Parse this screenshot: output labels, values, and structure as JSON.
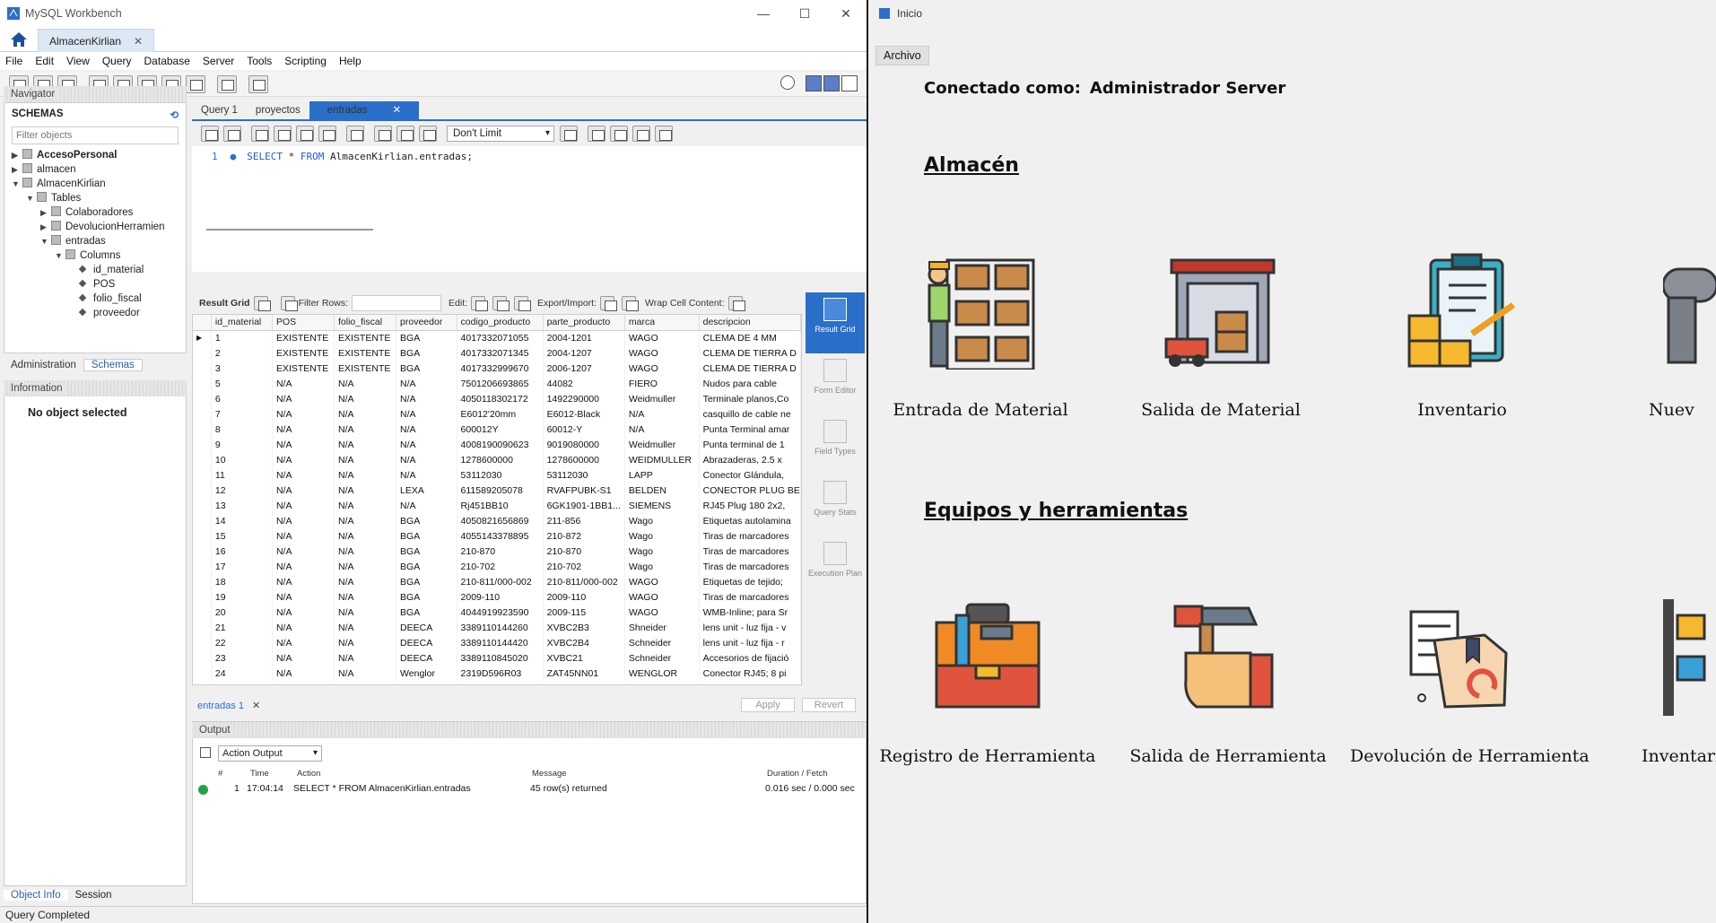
{
  "workbench": {
    "title": "MySQL Workbench",
    "connection_tab": "AlmacenKirlian",
    "menu": [
      "File",
      "Edit",
      "View",
      "Query",
      "Database",
      "Server",
      "Tools",
      "Scripting",
      "Help"
    ],
    "navigator_label": "Navigator",
    "schemas_label": "SCHEMAS",
    "filter_placeholder": "Filter objects",
    "tree": [
      {
        "label": "AccesoPersonal",
        "bold": true,
        "level": 0,
        "arrow": "▶",
        "icon": "db"
      },
      {
        "label": "almacen",
        "bold": false,
        "level": 0,
        "arrow": "▶",
        "icon": "db"
      },
      {
        "label": "AlmacenKirlian",
        "bold": false,
        "level": 0,
        "arrow": "▼",
        "icon": "db"
      },
      {
        "label": "Tables",
        "bold": false,
        "level": 1,
        "arrow": "▼",
        "icon": "folder"
      },
      {
        "label": "Colaboradores",
        "bold": false,
        "level": 2,
        "arrow": "▶",
        "icon": "table"
      },
      {
        "label": "DevolucionHerramien",
        "bold": false,
        "level": 2,
        "arrow": "▶",
        "icon": "table"
      },
      {
        "label": "entradas",
        "bold": false,
        "level": 2,
        "arrow": "▼",
        "icon": "table"
      },
      {
        "label": "Columns",
        "bold": false,
        "level": 3,
        "arrow": "▼",
        "icon": "folder"
      },
      {
        "label": "id_material",
        "bold": false,
        "level": 4,
        "arrow": "",
        "icon": "col"
      },
      {
        "label": "POS",
        "bold": false,
        "level": 4,
        "arrow": "",
        "icon": "col"
      },
      {
        "label": "folio_fiscal",
        "bold": false,
        "level": 4,
        "arrow": "",
        "icon": "col"
      },
      {
        "label": "proveedor",
        "bold": false,
        "level": 4,
        "arrow": "",
        "icon": "col"
      }
    ],
    "nav_tabs": [
      "Administration",
      "Schemas"
    ],
    "information_label": "Information",
    "no_object": "No object selected",
    "info_tabs": [
      "Object Info",
      "Session"
    ],
    "status": "Query Completed",
    "query_tabs": [
      "Query 1",
      "proyectos",
      "entradas"
    ],
    "limit": "Don't Limit",
    "sql": {
      "line": "1",
      "keyword1": "SELECT",
      "star": "*",
      "keyword2": "FROM",
      "rest": "AlmacenKirlian.entradas;"
    },
    "result_toolbar": {
      "result_grid": "Result Grid",
      "filter_rows": "Filter Rows:",
      "edit": "Edit:",
      "export": "Export/Import:",
      "wrap": "Wrap Cell Content:"
    },
    "grid_columns": [
      "id_material",
      "POS",
      "folio_fiscal",
      "proveedor",
      "codigo_producto",
      "parte_producto",
      "marca",
      "descripcion"
    ],
    "grid_rows": [
      [
        "1",
        "EXISTENTE",
        "EXISTENTE",
        "BGA",
        "4017332071055",
        "2004-1201",
        "WAGO",
        "CLEMA DE 4 MM"
      ],
      [
        "2",
        "EXISTENTE",
        "EXISTENTE",
        "BGA",
        "4017332071345",
        "2004-1207",
        "WAGO",
        "CLEMA DE TIERRA D"
      ],
      [
        "3",
        "EXISTENTE",
        "EXISTENTE",
        "BGA",
        "4017332999670",
        "2006-1207",
        "WAGO",
        "CLEMA DE TIERRA D"
      ],
      [
        "5",
        "N/A",
        "N/A",
        "N/A",
        "7501206693865",
        "44082",
        "FIERO",
        "Nudos para cable"
      ],
      [
        "6",
        "N/A",
        "N/A",
        "N/A",
        "4050118302172",
        "1492290000",
        "Weidmuller",
        "Terminale planos,Co"
      ],
      [
        "7",
        "N/A",
        "N/A",
        "N/A",
        "E6012'20mm",
        "E6012-Black",
        "N/A",
        "casquillo de cable ne"
      ],
      [
        "8",
        "N/A",
        "N/A",
        "N/A",
        "600012Y",
        "60012-Y",
        "N/A",
        "Punta Terminal amar"
      ],
      [
        "9",
        "N/A",
        "N/A",
        "N/A",
        "4008190090623",
        "9019080000",
        "Weidmuller",
        "Punta terminal de 1"
      ],
      [
        "10",
        "N/A",
        "N/A",
        "N/A",
        "1278600000",
        "1278600000",
        "WEIDMULLER",
        "Abrazaderas, 2.5 x"
      ],
      [
        "11",
        "N/A",
        "N/A",
        "N/A",
        "53112030",
        "53112030",
        "LAPP",
        "Conector Glándula,"
      ],
      [
        "12",
        "N/A",
        "N/A",
        "LEXA",
        "611589205078",
        "RVAFPUBK-S1",
        "BELDEN",
        "CONECTOR PLUG BE"
      ],
      [
        "13",
        "N/A",
        "N/A",
        "N/A",
        "Rj451BB10",
        "6GK1901-1BB1...",
        "SIEMENS",
        "RJ45 Plug 180 2x2,"
      ],
      [
        "14",
        "N/A",
        "N/A",
        "BGA",
        "4050821656869",
        "211-856",
        "Wago",
        "Etiquetas autolamina"
      ],
      [
        "15",
        "N/A",
        "N/A",
        "BGA",
        "4055143378895",
        "210-872",
        "Wago",
        "Tiras de marcadores"
      ],
      [
        "16",
        "N/A",
        "N/A",
        "BGA",
        "210-870",
        "210-870",
        "Wago",
        "Tiras de marcadores"
      ],
      [
        "17",
        "N/A",
        "N/A",
        "BGA",
        "210-702",
        "210-702",
        "Wago",
        "Tiras de marcadores"
      ],
      [
        "18",
        "N/A",
        "N/A",
        "BGA",
        "210-811/000-002",
        "210-811/000-002",
        "WAGO",
        "Etiquetas de tejido;"
      ],
      [
        "19",
        "N/A",
        "N/A",
        "BGA",
        "2009-110",
        "2009-110",
        "WAGO",
        "Tiras de marcadores"
      ],
      [
        "20",
        "N/A",
        "N/A",
        "BGA",
        "4044919923590",
        "2009-115",
        "WAGO",
        "WMB-Inline; para Sr"
      ],
      [
        "21",
        "N/A",
        "N/A",
        "DEECA",
        "3389110144260",
        "XVBC2B3",
        "Shneider",
        "lens unit - luz fija - v"
      ],
      [
        "22",
        "N/A",
        "N/A",
        "DEECA",
        "3389110144420",
        "XVBC2B4",
        "Schneider",
        "lens unit - luz fija - r"
      ],
      [
        "23",
        "N/A",
        "N/A",
        "DEECA",
        "3389110845020",
        "XVBC21",
        "Schneider",
        "Accesorios de fijació"
      ],
      [
        "24",
        "N/A",
        "N/A",
        "Wenglor",
        "2319D596R03",
        "ZAT45NN01",
        "WENGLOR",
        "Conector RJ45; 8 pi"
      ]
    ],
    "side_tabs": [
      "Result Grid",
      "Form Editor",
      "Field Types",
      "Query Stats",
      "Execution Plan"
    ],
    "result_tab": "entradas 1",
    "apply": "Apply",
    "revert": "Revert",
    "output_label": "Output",
    "action_output": "Action Output",
    "output_headers": {
      "num": "#",
      "time": "Time",
      "action": "Action",
      "message": "Message",
      "duration": "Duration / Fetch"
    },
    "output_row": {
      "num": "1",
      "time": "17:04:14",
      "action": "SELECT * FROM AlmacenKirlian.entradas",
      "message": "45 row(s) returned",
      "duration": "0.016 sec / 0.000 sec"
    }
  },
  "app": {
    "title": "Inicio",
    "menu": "Archivo",
    "connected_label": "Conectado como:",
    "connected_user": "Administrador Server",
    "section1": "Almacén",
    "section2": "Equipos y herramientas",
    "almacen_items": [
      "Entrada de Material",
      "Salida de Material",
      "Inventario",
      "Nuev"
    ],
    "herramientas_items": [
      "Registro de Herramienta",
      "Salida de Herramienta",
      "Devolución de Herramienta",
      "Inventario d"
    ]
  }
}
